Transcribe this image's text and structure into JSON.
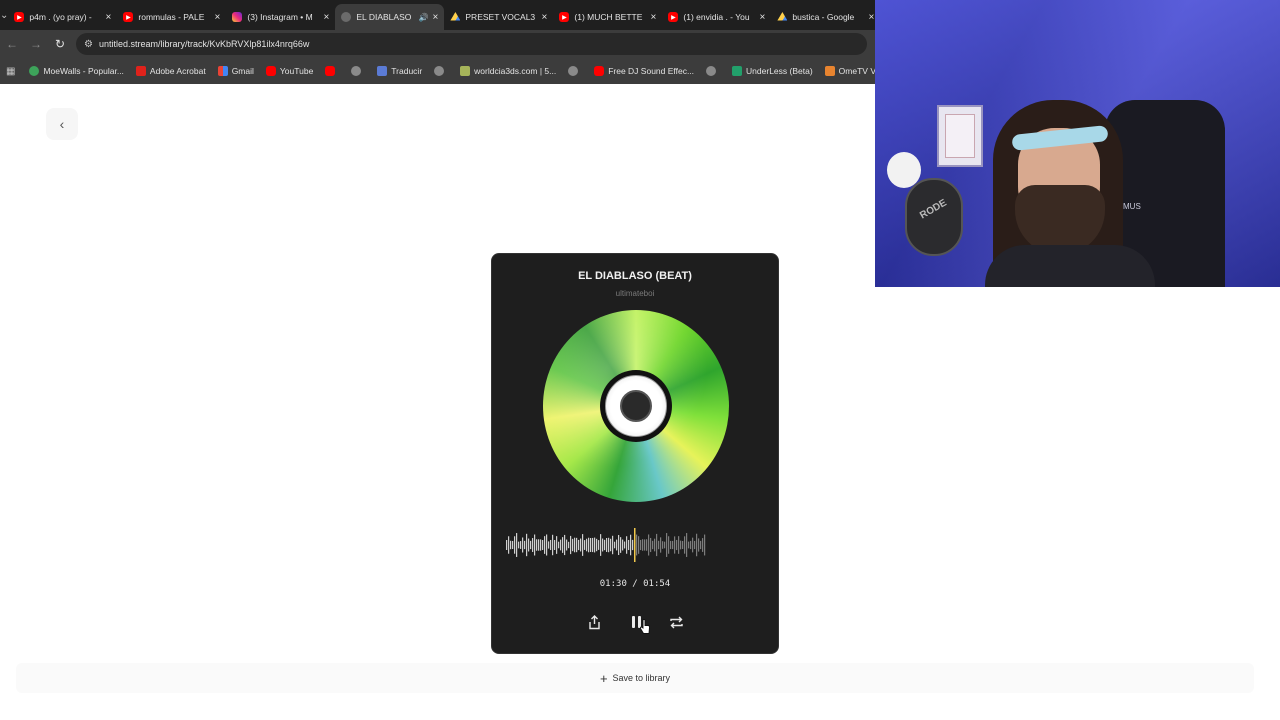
{
  "browser": {
    "tabs": [
      {
        "title": "p4m . (yo pray) - ",
        "favicon": "youtube-icon",
        "active": false
      },
      {
        "title": "rommulas - PALE",
        "favicon": "youtube-icon",
        "active": false
      },
      {
        "title": "(3) Instagram • M",
        "favicon": "instagram-icon",
        "active": false
      },
      {
        "title": "EL DIABLASO",
        "favicon": "globe-icon",
        "active": true,
        "audio": true
      },
      {
        "title": "PRESET VOCAL3",
        "favicon": "drive-icon",
        "active": false
      },
      {
        "title": "(1) MUCH BETTE",
        "favicon": "youtube-icon",
        "active": false
      },
      {
        "title": "(1) envidia . - You",
        "favicon": "youtube-icon",
        "active": false
      },
      {
        "title": "bustica - Google",
        "favicon": "drive-icon",
        "active": false
      }
    ],
    "url": "untitled.stream/library/track/KvKbRVXlp81ilx4nrq66w",
    "bookmarks": [
      {
        "label": "MoeWalls - Popular...",
        "favicon": "green"
      },
      {
        "label": "Adobe Acrobat",
        "favicon": "red"
      },
      {
        "label": "Gmail",
        "favicon": "gmail"
      },
      {
        "label": "YouTube",
        "favicon": "yt"
      },
      {
        "label": "",
        "favicon": "yt"
      },
      {
        "label": "",
        "favicon": "globe"
      },
      {
        "label": "Traducir",
        "favicon": "trad"
      },
      {
        "label": "",
        "favicon": "globe"
      },
      {
        "label": "worldcia3ds.com | 5...",
        "favicon": "world"
      },
      {
        "label": "",
        "favicon": "globe"
      },
      {
        "label": "Free DJ Sound Effec...",
        "favicon": "yt"
      },
      {
        "label": "",
        "favicon": "globe"
      },
      {
        "label": "UnderLess (Beta)",
        "favicon": "under"
      },
      {
        "label": "OmeTV Video Chat...",
        "favicon": "ome"
      }
    ]
  },
  "player": {
    "title": "EL DIABLASO (BEAT)",
    "artist": "ultimateboi",
    "current_time": "01:30",
    "separator": "/",
    "duration": "01:54",
    "progress": 0.79,
    "playing": true,
    "accent_color": "#f2c94c"
  },
  "save": {
    "label": "Save to library"
  },
  "webcam": {
    "mic_label": "RODE",
    "tag_text": "MUS"
  }
}
